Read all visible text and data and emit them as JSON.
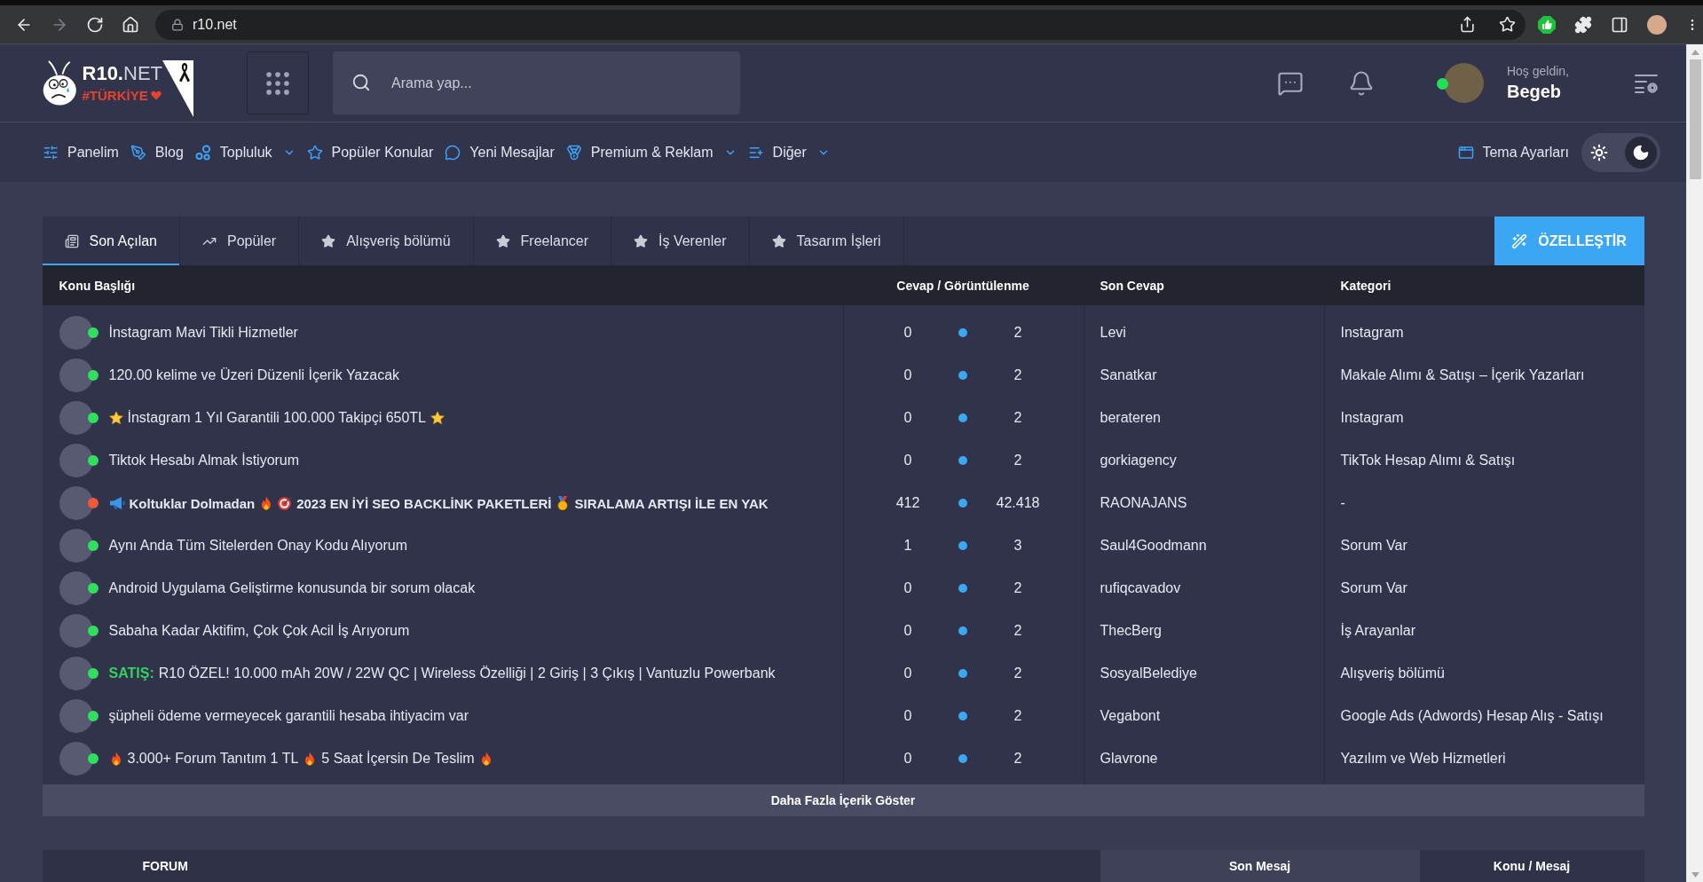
{
  "browser": {
    "url": "r10.net",
    "forward_disabled": true
  },
  "header": {
    "logo": {
      "name": "**R10.**NET",
      "tagline": "#TÜRKİYE"
    },
    "search": {
      "placeholder": "Arama yap..."
    },
    "user": {
      "greeting": "Hoş geldin,",
      "name": "Begeb",
      "online": true
    }
  },
  "nav": {
    "items": [
      {
        "label": "Panelim",
        "dropdown": false
      },
      {
        "label": "Blog",
        "dropdown": false
      },
      {
        "label": "Topluluk",
        "dropdown": true
      },
      {
        "label": "Popüler Konular",
        "dropdown": false
      },
      {
        "label": "Yeni Mesajlar",
        "dropdown": false
      },
      {
        "label": "Premium & Reklam",
        "dropdown": true
      },
      {
        "label": "Diğer",
        "dropdown": true
      }
    ],
    "theme_settings": "Tema Ayarları",
    "theme_toggle": {
      "dark": true
    }
  },
  "tabs": [
    {
      "label": "Son Açılan",
      "selected": true
    },
    {
      "label": "Popüler",
      "selected": false
    },
    {
      "label": "Alışveriş bölümü",
      "selected": false
    },
    {
      "label": "Freelancer",
      "selected": false
    },
    {
      "label": "İş Verenler",
      "selected": false
    },
    {
      "label": "Tasarım İşleri",
      "selected": false
    }
  ],
  "customize_button": "ÖZELLEŞTİR",
  "table": {
    "columns": [
      "Konu Başlığı",
      "Cevap / Görüntülenme",
      "Son Cevap",
      "Kategori"
    ],
    "rows": [
      {
        "title": [
          {
            "kind": "text",
            "text": "İnstagram Mavi Tikli Hizmetler"
          }
        ],
        "bold": false,
        "color": "#2ee05c",
        "replies": "0",
        "views": "2",
        "last_reply": "Levi",
        "category": "Instagram"
      },
      {
        "title": [
          {
            "kind": "text",
            "text": "120.00 kelime ve Üzeri Düzenli İçerik Yazacak"
          }
        ],
        "bold": false,
        "color": "#2ee05c",
        "replies": "0",
        "views": "2",
        "last_reply": "Sanatkar",
        "category": "Makale Alımı & Satışı – İçerik Yazarları"
      },
      {
        "title": [
          {
            "kind": "star"
          },
          {
            "kind": "text",
            "text": "İnstagram 1 Yıl Garantili 100.000 Takipçi 650TL"
          },
          {
            "kind": "star"
          }
        ],
        "bold": false,
        "color": "#2ee05c",
        "replies": "0",
        "views": "2",
        "last_reply": "berateren",
        "category": "Instagram"
      },
      {
        "title": [
          {
            "kind": "text",
            "text": "Tiktok Hesabı Almak İstiyorum"
          }
        ],
        "bold": false,
        "color": "#2ee05c",
        "replies": "0",
        "views": "2",
        "last_reply": "gorkiagency",
        "category": "TikTok Hesap Alımı & Satışı"
      },
      {
        "title": [
          {
            "kind": "megaphone"
          },
          {
            "kind": "text",
            "text": "Koltuklar Dolmadan"
          },
          {
            "kind": "flame"
          },
          {
            "kind": "target"
          },
          {
            "kind": "text",
            "text": "2023 EN İYİ SEO BACKLİNK PAKETLERİ"
          },
          {
            "kind": "medal"
          },
          {
            "kind": "text",
            "text": "SIRALAMA ARTIŞI İLE EN YAK"
          }
        ],
        "bold": true,
        "color": "#f0583c",
        "replies": "412",
        "views": "42.418",
        "last_reply": "RAONAJANS",
        "category": "-"
      },
      {
        "title": [
          {
            "kind": "text",
            "text": "Aynı Anda Tüm Sitelerden Onay Kodu Alıyorum"
          }
        ],
        "bold": false,
        "color": "#2ee05c",
        "replies": "1",
        "views": "3",
        "last_reply": "Saul4Goodmann",
        "category": "Sorum Var"
      },
      {
        "title": [
          {
            "kind": "text",
            "text": "Android Uygulama Geliştirme konusunda bir sorum olacak"
          }
        ],
        "bold": false,
        "color": "#2ee05c",
        "replies": "0",
        "views": "2",
        "last_reply": "rufiqcavadov",
        "category": "Sorum Var"
      },
      {
        "title": [
          {
            "kind": "text",
            "text": "Sabaha Kadar Aktifim, Çok Çok Acil İş Arıyorum"
          }
        ],
        "bold": false,
        "color": "#2ee05c",
        "replies": "0",
        "views": "2",
        "last_reply": "ThecBerg",
        "category": "İş Arayanlar"
      },
      {
        "title": [
          {
            "kind": "tag",
            "text": "SATIŞ:"
          },
          {
            "kind": "text",
            "text": "R10 ÖZEL! 10.000 mAh 20W / 22W QC | Wireless Özelliği | 2 Giriş | 3 Çıkış | Vantuzlu Powerbank"
          }
        ],
        "bold": false,
        "color": "#2ee05c",
        "replies": "0",
        "views": "2",
        "last_reply": "SosyalBelediye",
        "category": "Alışveriş bölümü"
      },
      {
        "title": [
          {
            "kind": "text",
            "text": "şüpheli ödeme vermeyecek garantili hesaba ihtiyacim var"
          }
        ],
        "bold": false,
        "color": "#2ee05c",
        "replies": "0",
        "views": "2",
        "last_reply": "Vegabont",
        "category": "Google Ads (Adwords) Hesap Alış - Satışı"
      },
      {
        "title": [
          {
            "kind": "flame"
          },
          {
            "kind": "text",
            "text": "3.000+ Forum Tanıtım 1 TL"
          },
          {
            "kind": "flame"
          },
          {
            "kind": "text",
            "text": "5 Saat İçersin De Teslim"
          },
          {
            "kind": "flame"
          }
        ],
        "bold": false,
        "color": "#2ee05c",
        "replies": "0",
        "views": "2",
        "last_reply": "Glavrone",
        "category": "Yazılım ve Web Hizmetleri"
      }
    ]
  },
  "more_button": "Daha Fazla İçerik Göster",
  "forum_table": {
    "columns": [
      "FORUM",
      "Son Mesaj",
      "Konu / Mesaj"
    ]
  }
}
